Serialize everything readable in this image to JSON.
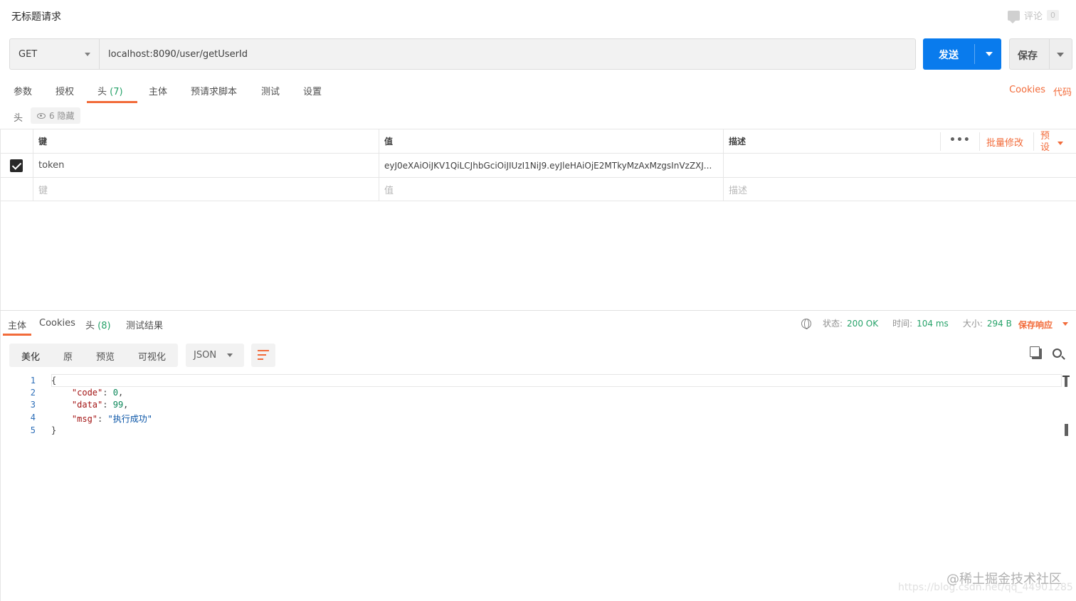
{
  "header": {
    "title": "无标题请求",
    "comments_label": "评论",
    "comments_count": "0"
  },
  "request": {
    "method": "GET",
    "url": "localhost:8090/user/getUserId",
    "send_label": "发送",
    "save_label": "保存"
  },
  "request_tabs": {
    "params": "参数",
    "auth": "授权",
    "headers": "头",
    "headers_count": "(7)",
    "body": "主体",
    "pre_request": "预请求脚本",
    "tests": "测试",
    "settings": "设置",
    "cookies": "Cookies",
    "code": "代码"
  },
  "headers_section": {
    "label": "头",
    "hidden_label": "6 隐藏"
  },
  "kv_table": {
    "col_key": "键",
    "col_value": "值",
    "col_desc": "描述",
    "more": "•••",
    "bulk_edit": "批量修改",
    "presets": "预设",
    "rows": [
      {
        "key": "token",
        "value": "eyJ0eXAiOiJKV1QiLCJhbGciOiJIUzI1NiJ9.eyJleHAiOjE2MTkyMzAxMzgsInVzZXJ...",
        "desc": ""
      }
    ],
    "placeholder_key": "键",
    "placeholder_value": "值",
    "placeholder_desc": "描述"
  },
  "response_tabs": {
    "body": "主体",
    "cookies": "Cookies",
    "headers": "头",
    "headers_count": "(8)",
    "test_results": "测试结果"
  },
  "response_meta": {
    "status_label": "状态:",
    "status_value": "200 OK",
    "time_label": "时间:",
    "time_value": "104 ms",
    "size_label": "大小:",
    "size_value": "294 B",
    "save_response": "保存响应"
  },
  "view_bar": {
    "pretty": "美化",
    "raw": "原",
    "preview": "预览",
    "visualize": "可视化",
    "format": "JSON"
  },
  "code": {
    "line_numbers": [
      "1",
      "2",
      "3",
      "4",
      "5"
    ],
    "open_brace": "{",
    "close_brace": "}",
    "lines": [
      {
        "key": "\"code\"",
        "value": "0"
      },
      {
        "key": "\"data\"",
        "value": "99"
      },
      {
        "key": "\"msg\"",
        "value": "\"执行成功\""
      }
    ]
  },
  "watermark": {
    "text": "@稀土掘金技术社区",
    "url": "https://blog.csdn.net/qq_44901285"
  },
  "colors": {
    "accent": "#f26b3a",
    "primary": "#097bed",
    "success": "#26a269"
  }
}
